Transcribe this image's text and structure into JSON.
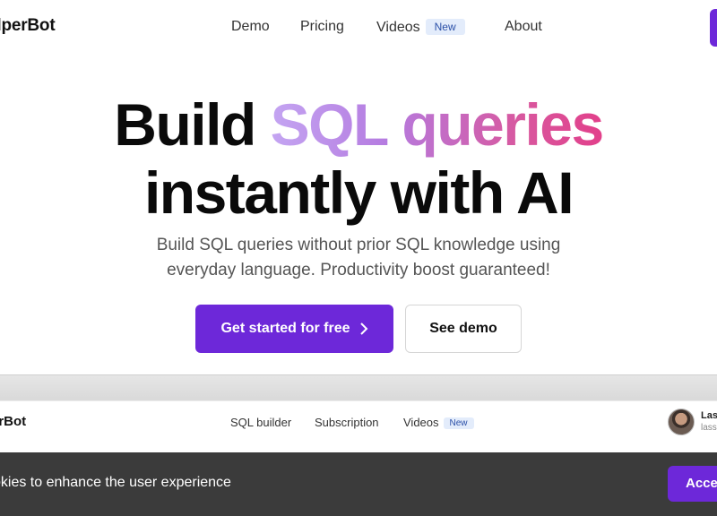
{
  "nav": {
    "brand": "elperBot",
    "links": [
      "Demo",
      "Pricing",
      "Videos",
      "About"
    ],
    "new_badge": "New"
  },
  "hero": {
    "line1_plain": "Build",
    "line1_gradient": "SQL queries",
    "line2": "instantly with AI",
    "subtitle_line1": "Build SQL queries without prior SQL knowledge using",
    "subtitle_line2": "everyday language. Productivity boost guaranteed!",
    "primary_cta": "Get started for free",
    "secondary_cta": "See demo"
  },
  "preview": {
    "brand": "erBot",
    "links": [
      "SQL builder",
      "Subscription",
      "Videos"
    ],
    "new_badge": "New",
    "user_name": "Lass",
    "user_sub": "lass"
  },
  "cookie_banner": {
    "text": "okies to enhance the user experience",
    "button": "Accep"
  },
  "colors": {
    "accent": "#6d28d9",
    "gradient_start": "#c4a5f2",
    "gradient_end": "#e23f8a",
    "banner_bg": "#3b3b3b"
  }
}
